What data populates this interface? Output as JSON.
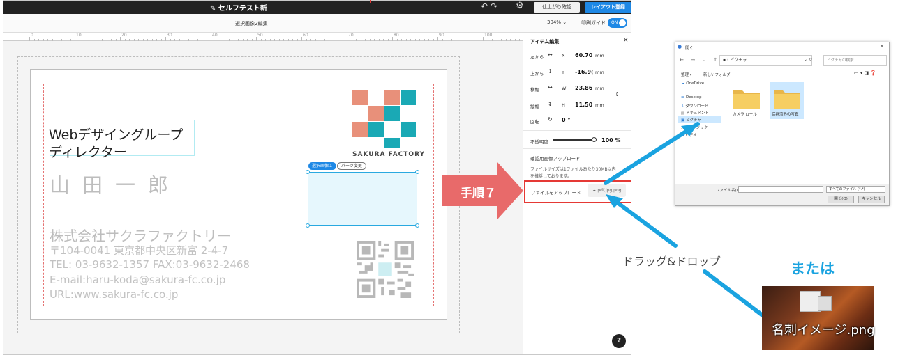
{
  "topbar": {
    "doc_title": "✎ セルフテスト新",
    "undo_redo": "↶  ↷",
    "check_label": "仕上がり確認",
    "register_label": "レイアウト登録"
  },
  "toolbar": {
    "edit_label": "選択画像2編集",
    "zoom": "304%  ⌄",
    "print_guide_label": "印刷ガイド",
    "toggle_label": "ON"
  },
  "ruler": {
    "numbers": [
      "0",
      "10",
      "20",
      "30",
      "40",
      "50",
      "60",
      "70",
      "80",
      "90",
      "100"
    ]
  },
  "card": {
    "jobtitle_line1": "Webデザイングループ",
    "jobtitle_line2": "ディレクター",
    "person_name": "山田一郎",
    "company": "株式会社サクラファクトリー",
    "address": "〒104-0041 東京都中央区新富 2-4-7",
    "tel": "TEL: 03-9632-1357   FAX:03-9632-2468",
    "email": "E-mail:haru-koda@sakura-fc.co.jp",
    "url": "URL:www.sakura-fc.co.jp",
    "logo_text": "SAKURA FACTORY",
    "tag_selected": "選択画像１",
    "tag_parts": "パーツ変更"
  },
  "panel": {
    "title": "アイテム編集",
    "close": "×",
    "rows": [
      {
        "label": "左から",
        "icon": "↔",
        "axis": "X",
        "value": "60.70",
        "unit": "mm"
      },
      {
        "label": "上から",
        "icon": "↕",
        "axis": "Y",
        "value": "-16.9(",
        "unit": "mm"
      },
      {
        "label": "横幅",
        "icon": "↔",
        "axis": "W",
        "value": "23.86",
        "unit": "mm"
      },
      {
        "label": "縦幅",
        "icon": "↕",
        "axis": "H",
        "value": "11.50",
        "unit": "mm"
      },
      {
        "label": "回転",
        "icon": "↻",
        "axis": "",
        "value": "0 °",
        "unit": ""
      }
    ],
    "opacity_label": "不透明度",
    "opacity_value": "100 %",
    "opacity_level": 1.0,
    "upload_title": "確認用画像アップロード",
    "upload_note1": "ファイルサイズは1ファイルあたり30MB以内",
    "upload_note2": "を推奨しております。",
    "upload_label": "ファイルをアップロード",
    "upload_button": "pdf,jpg,png",
    "help": "?"
  },
  "step_label": "手順７",
  "dialog": {
    "title": "開く",
    "close": "×",
    "nav": "← → ⌄ ↑",
    "path": "▪ › ピクチャ",
    "path_controls": "⌄  ↻",
    "search_placeholder": "ピクチャの検索",
    "organize": "整理 ▾",
    "new_folder": "新しいフォルダー",
    "view_icons": "▭ ▾  ◨  ❓",
    "nav_items": [
      "OneDrive",
      "Desktop",
      "ダウンロード",
      "ドキュメント",
      "ピクチャ",
      "ミュージック",
      "ビデオ"
    ],
    "folders": [
      "カメラ ロール",
      "保存済みの写真"
    ],
    "filename_label": "ファイル名(N):",
    "filetype": "すべてのファイル (*.*)",
    "open_button": "開く(O)",
    "cancel_button": "キャンセル"
  },
  "annotations": {
    "drag_drop": "ドラッグ&ドロップ",
    "or": "または",
    "thumbnail_name": "名刺イメージ.png"
  },
  "colors": {
    "accent_blue": "#1e88e5",
    "highlight_red": "#e53935",
    "step_arrow": "#e86a6a",
    "annotation_arrow": "#1aa3e0",
    "logo_coral": "#e8907a",
    "logo_teal": "#1aa9b5"
  }
}
